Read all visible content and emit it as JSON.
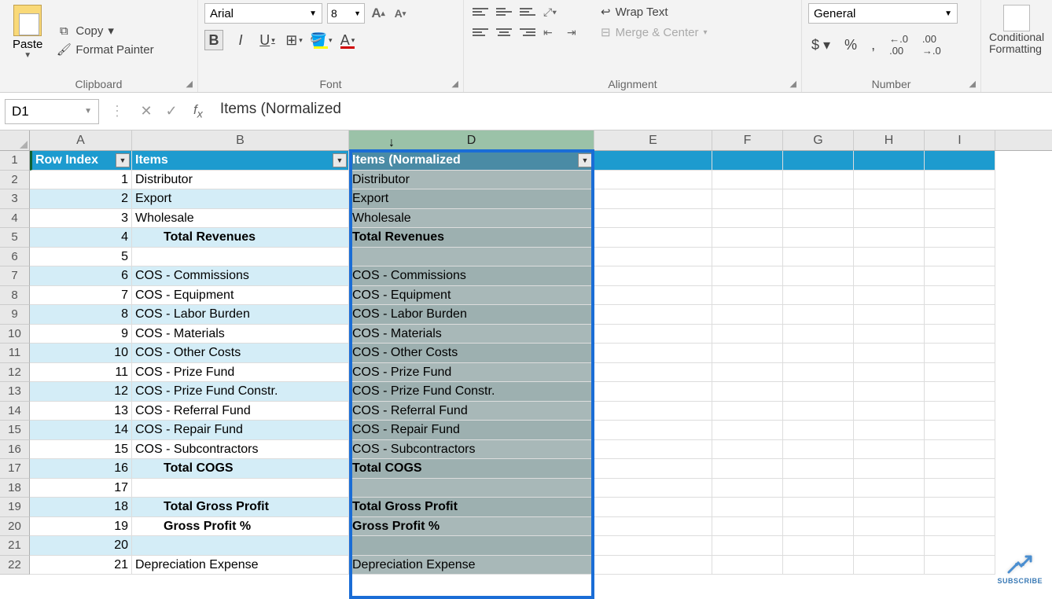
{
  "ribbon": {
    "clipboard": {
      "paste": "Paste",
      "copy": "Copy",
      "format_painter": "Format Painter",
      "label": "Clipboard"
    },
    "font": {
      "name": "Arial",
      "size": "8",
      "label": "Font"
    },
    "alignment": {
      "wrap_text": "Wrap Text",
      "merge_center": "Merge & Center",
      "label": "Alignment"
    },
    "number": {
      "format": "General",
      "label": "Number"
    },
    "styles": {
      "conditional_formatting": "Conditional Formatting"
    }
  },
  "formula_bar": {
    "name_box": "D1",
    "formula": "Items (Normalized"
  },
  "columns": [
    "A",
    "B",
    "D",
    "E",
    "F",
    "G",
    "H",
    "I"
  ],
  "selected_column": "D",
  "table": {
    "headers": {
      "a": "Row Index",
      "b": "Items",
      "d": "Items (Normalized"
    },
    "rows": [
      {
        "n": 1,
        "idx": "1",
        "b": "Distributor",
        "d": "Distributor",
        "bold": false,
        "indent": false,
        "alt": false
      },
      {
        "n": 2,
        "idx": "2",
        "b": "Export",
        "d": "Export",
        "bold": false,
        "indent": false,
        "alt": true
      },
      {
        "n": 3,
        "idx": "3",
        "b": "Wholesale",
        "d": "Wholesale",
        "bold": false,
        "indent": false,
        "alt": false
      },
      {
        "n": 4,
        "idx": "4",
        "b": "Total Revenues",
        "d": "Total Revenues",
        "bold": true,
        "indent": true,
        "alt": true
      },
      {
        "n": 5,
        "idx": "5",
        "b": "",
        "d": "",
        "bold": false,
        "indent": false,
        "alt": false
      },
      {
        "n": 6,
        "idx": "6",
        "b": "COS - Commissions",
        "d": "COS - Commissions",
        "bold": false,
        "indent": false,
        "alt": true
      },
      {
        "n": 7,
        "idx": "7",
        "b": "COS - Equipment",
        "d": "COS - Equipment",
        "bold": false,
        "indent": false,
        "alt": false
      },
      {
        "n": 8,
        "idx": "8",
        "b": "COS - Labor Burden",
        "d": "COS - Labor Burden",
        "bold": false,
        "indent": false,
        "alt": true
      },
      {
        "n": 9,
        "idx": "9",
        "b": "COS - Materials",
        "d": "COS - Materials",
        "bold": false,
        "indent": false,
        "alt": false
      },
      {
        "n": 10,
        "idx": "10",
        "b": "COS - Other Costs",
        "d": "COS - Other Costs",
        "bold": false,
        "indent": false,
        "alt": true
      },
      {
        "n": 11,
        "idx": "11",
        "b": "COS - Prize Fund",
        "d": "COS - Prize Fund",
        "bold": false,
        "indent": false,
        "alt": false
      },
      {
        "n": 12,
        "idx": "12",
        "b": "COS - Prize Fund Constr.",
        "d": "COS - Prize Fund Constr.",
        "bold": false,
        "indent": false,
        "alt": true
      },
      {
        "n": 13,
        "idx": "13",
        "b": "COS - Referral Fund",
        "d": "COS - Referral Fund",
        "bold": false,
        "indent": false,
        "alt": false
      },
      {
        "n": 14,
        "idx": "14",
        "b": "COS - Repair Fund",
        "d": "COS - Repair Fund",
        "bold": false,
        "indent": false,
        "alt": true
      },
      {
        "n": 15,
        "idx": "15",
        "b": "COS - Subcontractors",
        "d": "COS - Subcontractors",
        "bold": false,
        "indent": false,
        "alt": false
      },
      {
        "n": 16,
        "idx": "16",
        "b": "Total COGS",
        "d": "Total COGS",
        "bold": true,
        "indent": true,
        "alt": true
      },
      {
        "n": 17,
        "idx": "17",
        "b": "",
        "d": "",
        "bold": false,
        "indent": false,
        "alt": false
      },
      {
        "n": 18,
        "idx": "18",
        "b": "Total Gross Profit",
        "d": "Total Gross Profit",
        "bold": true,
        "indent": true,
        "alt": true
      },
      {
        "n": 19,
        "idx": "19",
        "b": "Gross Profit %",
        "d": "Gross Profit %",
        "bold": true,
        "indent": true,
        "alt": false
      },
      {
        "n": 20,
        "idx": "20",
        "b": "",
        "d": "",
        "bold": false,
        "indent": false,
        "alt": true
      },
      {
        "n": 21,
        "idx": "21",
        "b": "Depreciation Expense",
        "d": "Depreciation Expense",
        "bold": false,
        "indent": false,
        "alt": false
      }
    ]
  },
  "subscribe": "SUBSCRIBE"
}
